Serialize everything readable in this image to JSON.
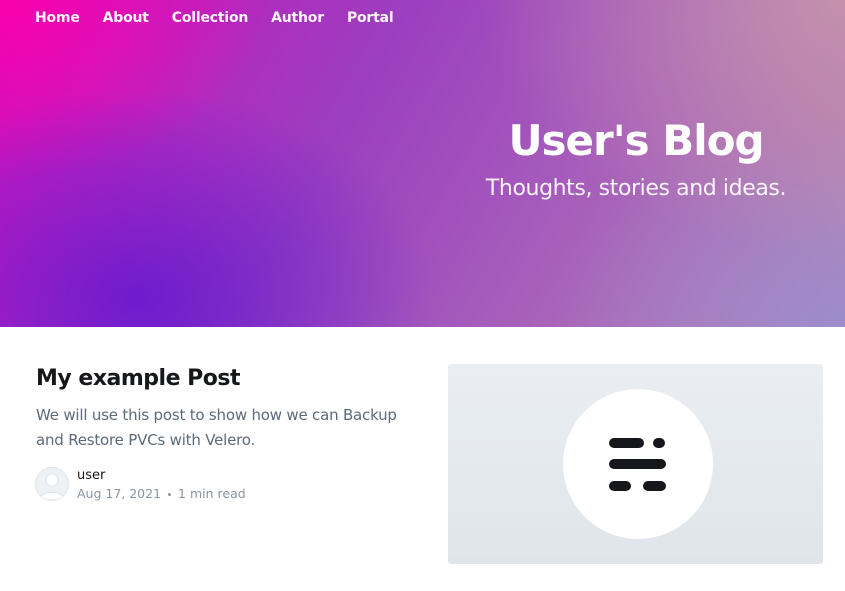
{
  "nav": {
    "items": [
      {
        "label": "Home"
      },
      {
        "label": "About"
      },
      {
        "label": "Collection"
      },
      {
        "label": "Author"
      },
      {
        "label": "Portal"
      }
    ]
  },
  "header": {
    "title": "User's Blog",
    "description": "Thoughts, stories and ideas."
  },
  "post": {
    "title": "My example Post",
    "excerpt": "We will use this post to show how we can Backup and Restore PVCs with Velero.",
    "author": "user",
    "date": "Aug 17, 2021",
    "reading_time": "1 min read",
    "image_icon": "ghost-placeholder-icon"
  },
  "colors": {
    "hero_pink": "#ff00aa",
    "hero_purple": "#5a14d2",
    "title_text": "#15171a",
    "excerpt_text": "#5d6a78",
    "meta_text": "#8b96a1"
  }
}
